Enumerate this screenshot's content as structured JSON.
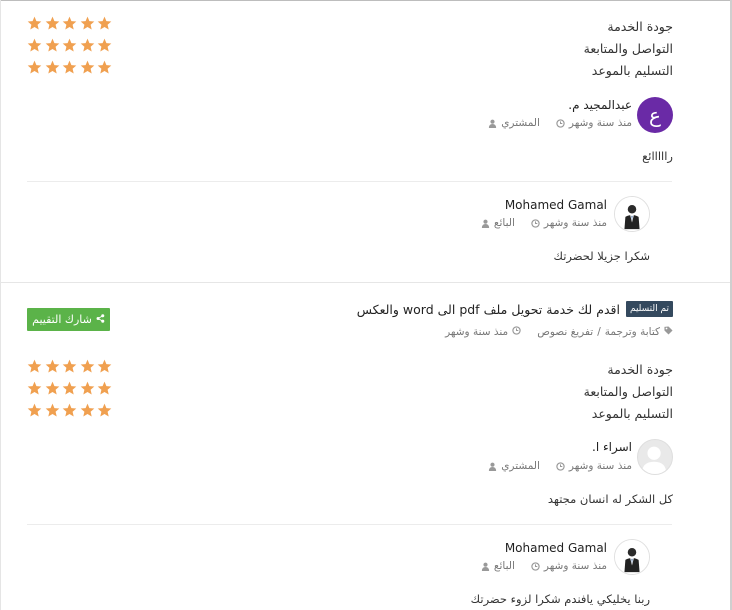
{
  "colors": {
    "star": "#f0a050",
    "share_button": "#5bb349",
    "badge": "#34495e",
    "avatar_buyer1": "#6a2aa6"
  },
  "review1": {
    "ratings": [
      {
        "label": "جودة الخدمة",
        "stars": 5
      },
      {
        "label": "التواصل والمتابعة",
        "stars": 5
      },
      {
        "label": "التسليم بالموعد",
        "stars": 5
      }
    ],
    "buyer": {
      "avatar_letter": "ع",
      "name": "عبدالمجيد م.",
      "role": "المشتري",
      "time": "منذ سنة وشهر",
      "comment": "رااااائع"
    },
    "seller": {
      "name": "Mohamed Gamal",
      "role": "البائع",
      "time": "منذ سنة وشهر",
      "comment": "شكرا جزيلا لحضرتك"
    }
  },
  "review2": {
    "share_label": "شارك التقييم",
    "badge": "تم التسليم",
    "service_title": "اقدم لك خدمة تحويل ملف pdf الى word والعكس",
    "category": "كتابة وترجمة",
    "subcategory": "تفريغ نصوص",
    "service_time": "منذ سنة وشهر",
    "ratings": [
      {
        "label": "جودة الخدمة",
        "stars": 5
      },
      {
        "label": "التواصل والمتابعة",
        "stars": 5
      },
      {
        "label": "التسليم بالموعد",
        "stars": 5
      }
    ],
    "buyer": {
      "name": "اسراء ا.",
      "role": "المشتري",
      "time": "منذ سنة وشهر",
      "comment": "كل الشكر له انسان مجتهد"
    },
    "seller": {
      "name": "Mohamed Gamal",
      "role": "البائع",
      "time": "منذ سنة وشهر",
      "comment": "ربنا يخليكي يافندم شكرا لزوء حضرتك"
    }
  }
}
